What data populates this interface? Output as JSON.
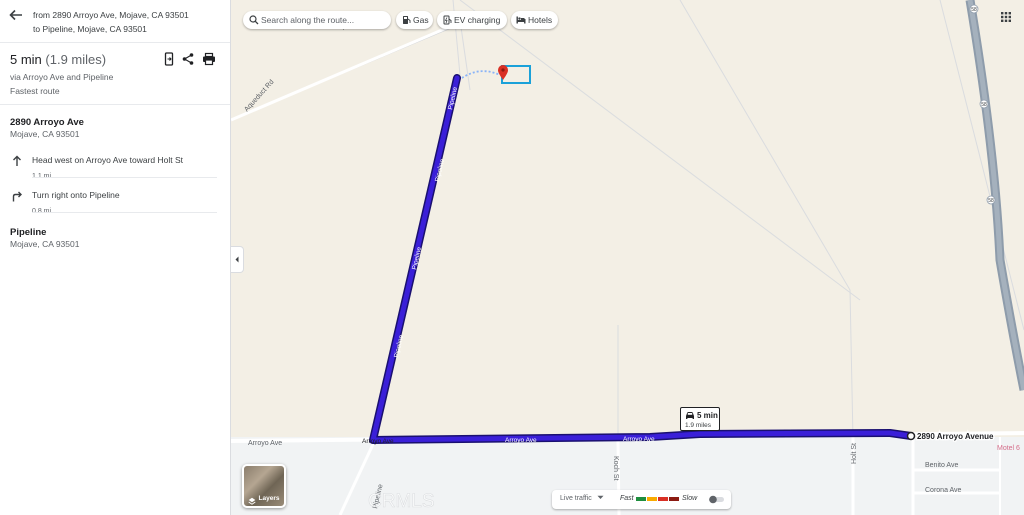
{
  "directions": {
    "from_label": "from 2890 Arroyo Ave, Mojave, CA 93501",
    "to_label": "to Pipeline, Mojave, CA 93501"
  },
  "route": {
    "duration": "5 min",
    "distance": "(1.9 miles)",
    "via": "via Arroyo Ave and Pipeline",
    "tag": "Fastest route"
  },
  "origin": {
    "name": "2890 Arroyo Ave",
    "address": "Mojave, CA 93501"
  },
  "steps": [
    {
      "icon": "arrow-up-icon",
      "text": "Head west on Arroyo Ave toward Holt St",
      "distance": "1.1 mi"
    },
    {
      "icon": "turn-right-icon",
      "text": "Turn right onto Pipeline",
      "distance": "0.8 mi"
    }
  ],
  "destination": {
    "name": "Pipeline",
    "address": "Mojave, CA 93501"
  },
  "toolbar": {
    "search_placeholder": "Search along the route...",
    "chips": [
      "Gas",
      "EV charging",
      "Hotels"
    ]
  },
  "map": {
    "road_labels": {
      "aqueduct": "Aqueduct Rd",
      "aqued": "Aqued",
      "arroyo_west": "Arroyo Ave",
      "arroyo_1": "Arroyo Ave",
      "arroyo_2": "Arroyo Ave",
      "arroyo_3": "Arroyo Ave",
      "pipeline_1": "Pipeline",
      "pipeline_2": "Pipeline",
      "pipeline_3": "Pipeline",
      "pipeline_4": "Pipeline",
      "pipeline_5": "Pipeline",
      "pipeline_south": "Pipeline",
      "koch": "Koch St",
      "holt": "Holt St",
      "benito": "Benito Ave",
      "corona": "Corona Ave",
      "motel": "Motel 6",
      "shield_1": "58",
      "shield_2": "58",
      "shield_3": "58"
    },
    "end_label": "2890 Arroyo Avenue",
    "callout_time": "5 min",
    "callout_distance": "1.9 miles",
    "watermark": "CRMLS",
    "route_color": "#3a1fd8"
  },
  "controls": {
    "layers_label": "Layers",
    "live_traffic": "Live traffic",
    "fast": "Fast",
    "slow": "Slow"
  }
}
